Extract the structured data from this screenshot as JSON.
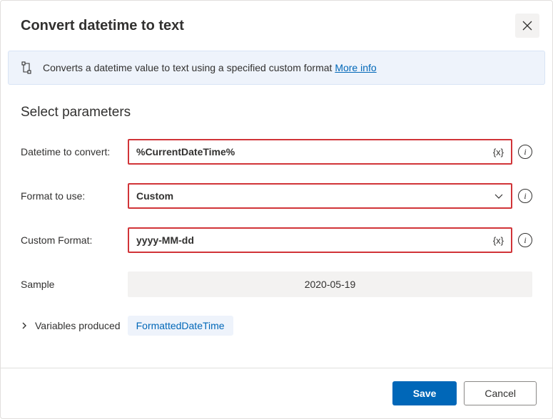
{
  "header": {
    "title": "Convert datetime to text"
  },
  "banner": {
    "text": "Converts a datetime value to text using a specified custom format ",
    "more_info": "More info"
  },
  "section": {
    "title": "Select parameters"
  },
  "fields": {
    "datetime": {
      "label": "Datetime to convert:",
      "value": "%CurrentDateTime%",
      "token": "{x}"
    },
    "format": {
      "label": "Format to use:",
      "value": "Custom"
    },
    "custom": {
      "label": "Custom Format:",
      "value": "yyyy-MM-dd",
      "token": "{x}"
    },
    "sample": {
      "label": "Sample",
      "value": "2020-05-19"
    }
  },
  "variables": {
    "label": "Variables produced",
    "chip": "FormattedDateTime"
  },
  "footer": {
    "save": "Save",
    "cancel": "Cancel"
  }
}
